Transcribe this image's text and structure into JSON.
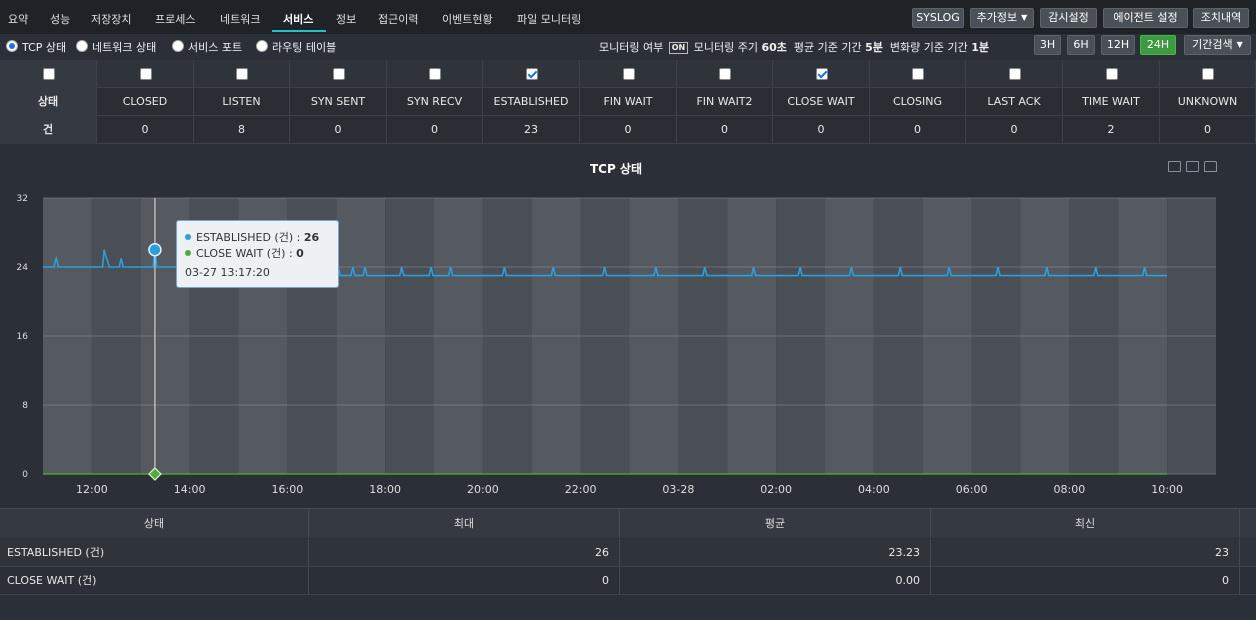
{
  "nav": {
    "tabs": [
      "요약",
      "성능",
      "저장장치",
      "프로세스",
      "네트워크",
      "서비스",
      "정보",
      "접근이력",
      "이벤트현황",
      "파일 모니터링"
    ],
    "active_tab": "서비스",
    "right_buttons": {
      "syslog": "SYSLOG",
      "extra_info": "추가정보",
      "monitor_settings": "감시설정",
      "agent_settings": "에이전트 설정",
      "actions": "조치내역"
    }
  },
  "subnav": {
    "radios": [
      "TCP 상태",
      "네트워크 상태",
      "서비스 포트",
      "라우팅 테이블"
    ],
    "selected_radio": "TCP 상태",
    "monitoring_label": "모니터링 여부",
    "monitoring_badge": "ON",
    "cycle_label": "모니터링 주기",
    "cycle_value": "60초",
    "avg_label": "평균 기준 기간",
    "avg_value": "5분",
    "change_label": "변화량 기준 기간",
    "change_value": "1분",
    "range_buttons": [
      "3H",
      "6H",
      "12H",
      "24H"
    ],
    "active_range": "24H",
    "period_search": "기간검색"
  },
  "state_table": {
    "row_header_state": "상태",
    "row_header_count": "건",
    "columns": [
      {
        "name": "CLOSED",
        "count": "0",
        "checked": false
      },
      {
        "name": "LISTEN",
        "count": "8",
        "checked": false
      },
      {
        "name": "SYN SENT",
        "count": "0",
        "checked": false
      },
      {
        "name": "SYN RECV",
        "count": "0",
        "checked": false
      },
      {
        "name": "ESTABLISHED",
        "count": "23",
        "checked": true
      },
      {
        "name": "FIN WAIT",
        "count": "0",
        "checked": false
      },
      {
        "name": "FIN WAIT2",
        "count": "0",
        "checked": false
      },
      {
        "name": "CLOSE WAIT",
        "count": "0",
        "checked": true
      },
      {
        "name": "CLOSING",
        "count": "0",
        "checked": false
      },
      {
        "name": "LAST ACK",
        "count": "0",
        "checked": false
      },
      {
        "name": "TIME WAIT",
        "count": "2",
        "checked": false
      },
      {
        "name": "UNKNOWN",
        "count": "0",
        "checked": false
      }
    ]
  },
  "chart_data": {
    "type": "line",
    "title": "TCP 상태",
    "xlabel": "",
    "ylabel": "",
    "ylim": [
      0,
      32
    ],
    "yticks": [
      0,
      8,
      16,
      24,
      32
    ],
    "xlim": [
      11.0,
      35.0
    ],
    "xticks": [
      {
        "t": 12,
        "label": "12:00"
      },
      {
        "t": 14,
        "label": "14:00"
      },
      {
        "t": 16,
        "label": "16:00"
      },
      {
        "t": 18,
        "label": "18:00"
      },
      {
        "t": 20,
        "label": "20:00"
      },
      {
        "t": 22,
        "label": "22:00"
      },
      {
        "t": 24,
        "label": "03-28"
      },
      {
        "t": 26,
        "label": "02:00"
      },
      {
        "t": 28,
        "label": "04:00"
      },
      {
        "t": 30,
        "label": "06:00"
      },
      {
        "t": 32,
        "label": "08:00"
      },
      {
        "t": 34,
        "label": "10:00"
      }
    ],
    "grid": true,
    "series": [
      {
        "name": "ESTABLISHED (건)",
        "color": "#2a9fe0",
        "points": [
          [
            11.0,
            24
          ],
          [
            11.22,
            24
          ],
          [
            11.27,
            25
          ],
          [
            11.32,
            24
          ],
          [
            12.22,
            24
          ],
          [
            12.25,
            26
          ],
          [
            12.3,
            25
          ],
          [
            12.36,
            24
          ],
          [
            12.56,
            24
          ],
          [
            12.6,
            25
          ],
          [
            12.64,
            24
          ],
          [
            13.25,
            24
          ],
          [
            13.29,
            26
          ],
          [
            13.33,
            24
          ],
          [
            15.0,
            24
          ],
          [
            15.04,
            25
          ],
          [
            15.08,
            24
          ],
          [
            16.0,
            24
          ],
          [
            16.04,
            25
          ],
          [
            16.08,
            24
          ],
          [
            17.0,
            23
          ],
          [
            17.04,
            24
          ],
          [
            17.08,
            23
          ],
          [
            17.3,
            23
          ],
          [
            17.34,
            24
          ],
          [
            17.38,
            23
          ],
          [
            17.55,
            23
          ],
          [
            17.59,
            24
          ],
          [
            17.63,
            23
          ],
          [
            18.3,
            23
          ],
          [
            18.34,
            24
          ],
          [
            18.38,
            23
          ],
          [
            18.9,
            23
          ],
          [
            18.94,
            24
          ],
          [
            18.98,
            23
          ],
          [
            19.3,
            23
          ],
          [
            19.34,
            24
          ],
          [
            19.38,
            23
          ],
          [
            20.4,
            23
          ],
          [
            20.44,
            24
          ],
          [
            20.48,
            23
          ],
          [
            21.4,
            23
          ],
          [
            21.44,
            24
          ],
          [
            21.48,
            23
          ],
          [
            22.45,
            23
          ],
          [
            22.49,
            24
          ],
          [
            22.53,
            23
          ],
          [
            23.5,
            23
          ],
          [
            23.54,
            24
          ],
          [
            23.58,
            23
          ],
          [
            24.5,
            23
          ],
          [
            24.54,
            24
          ],
          [
            24.58,
            23
          ],
          [
            25.5,
            23
          ],
          [
            25.54,
            24
          ],
          [
            25.58,
            23
          ],
          [
            26.45,
            23
          ],
          [
            26.49,
            24
          ],
          [
            26.53,
            23
          ],
          [
            27.5,
            23
          ],
          [
            27.54,
            24
          ],
          [
            27.58,
            23
          ],
          [
            28.5,
            23
          ],
          [
            28.54,
            24
          ],
          [
            28.58,
            23
          ],
          [
            29.5,
            23
          ],
          [
            29.54,
            24
          ],
          [
            29.58,
            23
          ],
          [
            30.5,
            23
          ],
          [
            30.54,
            24
          ],
          [
            30.58,
            23
          ],
          [
            31.5,
            23
          ],
          [
            31.54,
            24
          ],
          [
            31.58,
            23
          ],
          [
            32.5,
            23
          ],
          [
            32.54,
            24
          ],
          [
            32.58,
            23
          ],
          [
            33.5,
            23
          ],
          [
            33.54,
            24
          ],
          [
            33.58,
            23
          ],
          [
            33.95,
            23
          ],
          [
            34.0,
            23
          ]
        ]
      },
      {
        "name": "CLOSE WAIT (건)",
        "color": "#4caf30",
        "points": [
          [
            11.0,
            0
          ],
          [
            34.0,
            0
          ]
        ]
      }
    ],
    "crosshair_t": 13.29,
    "tooltip": {
      "series1_label": "ESTABLISHED (건) :",
      "series1_value": "26",
      "series2_label": "CLOSE WAIT (건) :",
      "series2_value": "0",
      "time": "03-27 13:17:20"
    }
  },
  "summary": {
    "headers": [
      "상태",
      "최대",
      "평균",
      "최신"
    ],
    "rows": [
      {
        "state": "ESTABLISHED (건)",
        "max": "26",
        "avg": "23.23",
        "latest": "23"
      },
      {
        "state": "CLOSE WAIT (건)",
        "max": "0",
        "avg": "0.00",
        "latest": "0"
      }
    ]
  }
}
